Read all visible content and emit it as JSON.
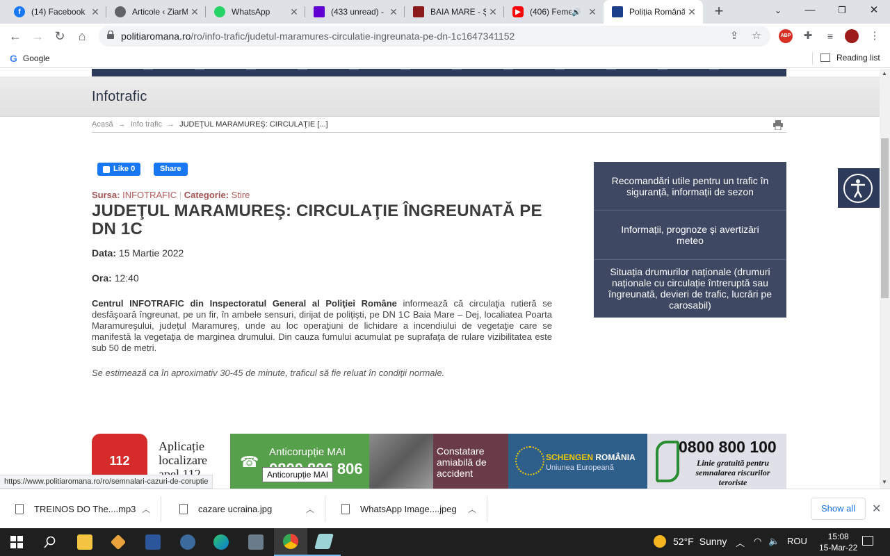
{
  "browser": {
    "tabs": [
      {
        "title": "(14) Facebook",
        "icon": "facebook-icon",
        "color": "#1877f2"
      },
      {
        "title": "Articole ‹ ZiarM",
        "icon": "globe-icon",
        "color": "#5f6368"
      },
      {
        "title": "WhatsApp",
        "icon": "whatsapp-icon",
        "color": "#25d366"
      },
      {
        "title": "(433 unread) -",
        "icon": "yahoo-mail-icon",
        "color": "#6001d2"
      },
      {
        "title": "BAIA MARE - Ș",
        "icon": "site-icon",
        "color": "#8b1a1a"
      },
      {
        "title": "(406) Feme",
        "icon": "youtube-icon",
        "color": "#ff0000"
      },
      {
        "title": "Poliția Română",
        "icon": "politia-crest-icon",
        "color": "#1c3f8c"
      }
    ],
    "url_domain": "politiaromana.ro",
    "url_path": "/ro/info-trafic/judetul-maramures-circulatie-ingreunata-pe-dn-1c1647341152",
    "bookmarks": {
      "google": "Google",
      "reading_list": "Reading list"
    }
  },
  "page": {
    "section_title": "Infotrafic",
    "breadcrumb": {
      "home": "Acasă",
      "sep": "→",
      "section": "Info trafic",
      "current": "JUDEŢUL MARAMUREŞ: CIRCULAŢIE [...]"
    },
    "fb": {
      "like": "Like 0",
      "share": "Share"
    },
    "meta": {
      "source_label": "Sursa:",
      "source": "INFOTRAFIC",
      "category_label": "Categorie:",
      "category": "Stire"
    },
    "title": "JUDEŢUL MARAMUREŞ: CIRCULAŢIE ÎNGREUNATĂ PE DN 1C",
    "date_label": "Data:",
    "date": "15 Martie 2022",
    "time_label": "Ora:",
    "time": "12:40",
    "body_bold": "Centrul INFOTRAFIC din Inspectoratul General al Poliţiei Române",
    "body_rest": " informează că circulaţia rutieră se desfăşoară îngreunat, pe un fir, în ambele sensuri, dirijat de poliţişti, pe DN 1C Baia Mare – Dej, localiatea Poarta Maramureşului, judeţul Maramureş, unde au loc operaţiuni de lichidare a incendiului de vegetaţie care se manifestă la vegetaţia de marginea drumului. Din cauza fumului acumulat pe suprafaţa de rulare vizibilitatea este sub 50 de metri.",
    "body_italic": "Se estimează ca în aproximativ 30-45 de minute, traficul să fie reluat în condiţii normale.",
    "sidebar": [
      "Recomandări utile pentru un trafic în siguranță, informații de sezon",
      "Informații, prognoze și avertizări meteo",
      "Situația drumurilor naționale (drumuri naționale cu circulație întreruptă sau îngreunată, devieri de trafic, lucrări pe carosabil)"
    ],
    "banners": {
      "app112_logo": "112",
      "app112_text": "Aplicație localizare apel 112",
      "anticoruptie_title": "Anticorupție MAI",
      "anticoruptie_phone": "0800 806 806",
      "constatare": "Constatare amiabilă de accident",
      "schengen_a": "SCHENGEN",
      "schengen_b": "ROMÂNIA",
      "schengen_sub": "Uniunea Europeană",
      "tel_number": "0800 800 100",
      "tel_text": "Linie gratuită pentru semnalarea riscurilor teroriste"
    },
    "status_url": "https://www.politiaromana.ro/ro/semnalari-cazuri-de-coruptie",
    "tooltip": "Anticorupție MAI"
  },
  "downloads": {
    "items": [
      "TREINOS DO The....mp3",
      "cazare ucraina.jpg",
      "WhatsApp Image....jpeg"
    ],
    "show_all": "Show all"
  },
  "taskbar": {
    "weather_temp": "52°F",
    "weather_desc": "Sunny",
    "language": "ROU",
    "time": "15:08",
    "date": "15-Mar-22"
  }
}
